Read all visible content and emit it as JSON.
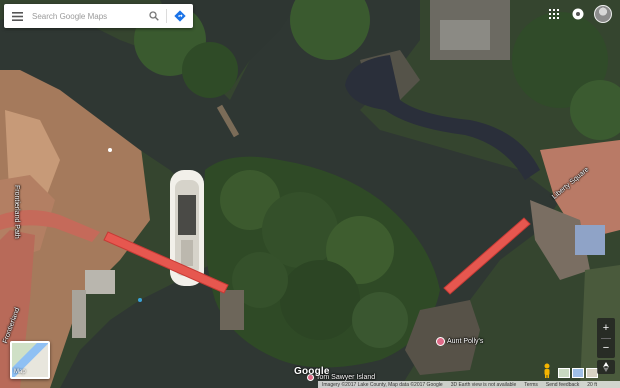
{
  "search": {
    "placeholder": "Search Google Maps"
  },
  "icons": {
    "menu": "menu-icon",
    "search": "search-icon",
    "directions": "directions-icon",
    "apps": "apps-grid-icon",
    "notifications": "notifications-icon",
    "account": "account-avatar",
    "zoom_in": "plus-icon",
    "zoom_out": "minus-icon",
    "compass": "compass-icon",
    "pegman": "pegman-icon"
  },
  "labels": {
    "street_vertical": "Frontierland Path",
    "street_diagonal": "Liberty Square",
    "street_bottom_left": "Frontierland",
    "poi_aunt_pollys": "Aunt Polly's",
    "poi_tom_sawyer": "Tom Sawyer Island"
  },
  "map_type": {
    "label": "Map"
  },
  "zoom": {
    "in": "+",
    "out": "−"
  },
  "logo": "Google",
  "attribution": {
    "imagery": "Imagery ©2017 Lake County, Map data ©2017 Google",
    "earth_view": "3D Earth view is not available",
    "terms": "Terms",
    "feedback": "Send feedback",
    "scale": "20 ft"
  },
  "colors": {
    "water": "#2f3733",
    "bridge": "#e6574f",
    "poi": "#e06a88",
    "directions": "#1a73e8",
    "path": "#c56a5a"
  }
}
